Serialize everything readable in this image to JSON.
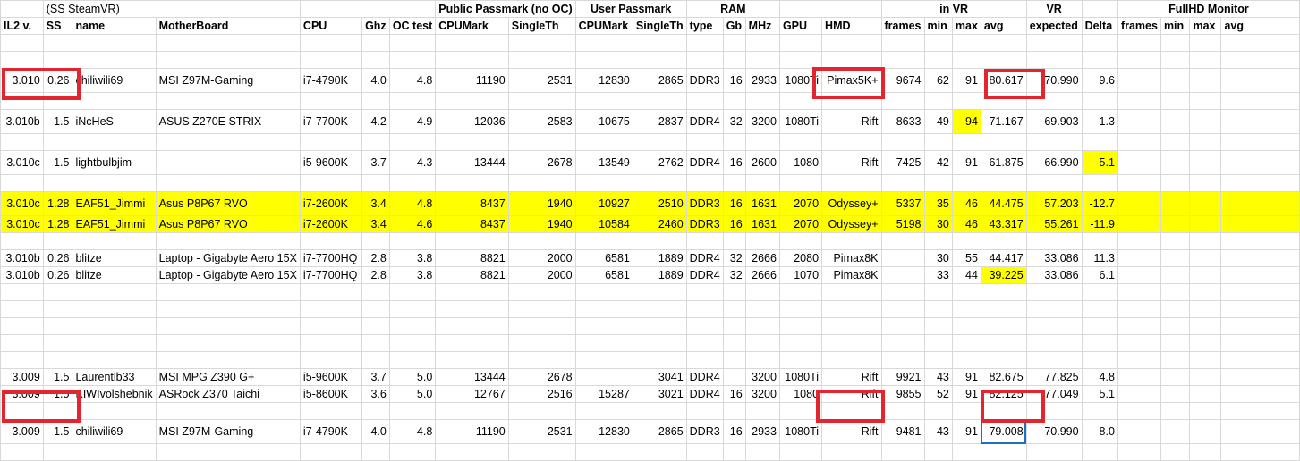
{
  "header": {
    "row1": {
      "ss_note": "(SS SteamVR)",
      "public_passmark": "Public Passmark (no OC)",
      "user_passmark": "User Passmark",
      "ram": "RAM",
      "in_vr": "in VR",
      "vr": "VR",
      "fullhd": "FullHD Monitor"
    },
    "columns": [
      "IL2 v.",
      "SS",
      "name",
      "MotherBoard",
      "CPU",
      "Ghz",
      "OC test",
      "CPUMark",
      "SingleTh",
      "CPUMark",
      "SingleTh",
      "type",
      "Gb",
      "MHz",
      "GPU",
      "HMD",
      "frames",
      "min",
      "max",
      "avg",
      "expected",
      "Delta",
      "frames",
      "min",
      "max",
      "avg"
    ]
  },
  "rows": [
    {
      "cells": [
        "3.010",
        "0.26",
        "chiliwili69",
        "MSI Z97M-Gaming",
        "i7-4790K",
        "4.0",
        "4.8",
        "11190",
        "2531",
        "12830",
        "2865",
        "DDR3",
        "16",
        "2933",
        "1080Ti",
        "Pimax5K+",
        "9674",
        "62",
        "91",
        "80.617",
        "70.990",
        "9.6"
      ]
    },
    {
      "cells": [
        "3.010b",
        "1.5",
        "iNcHeS",
        "ASUS Z270E STRIX",
        "i7-7700K",
        "4.2",
        "4.9",
        "12036",
        "2583",
        "10675",
        "2837",
        "DDR4",
        "32",
        "3200",
        "1080Ti",
        "Rift",
        "8633",
        "49",
        "94",
        "71.167",
        "69.903",
        "1.3"
      ]
    },
    {
      "cells": [
        "3.010c",
        "1.5",
        "lightbulbjim",
        "",
        "i5-9600K",
        "3.7",
        "4.3",
        "13444",
        "2678",
        "13549",
        "2762",
        "DDR4",
        "16",
        "2600",
        "1080",
        "Rift",
        "7425",
        "42",
        "91",
        "61.875",
        "66.990",
        "-5.1"
      ]
    },
    {
      "cells": [
        "3.010c",
        "1.28",
        "EAF51_Jimmi",
        "Asus P8P67 RVO",
        "i7-2600K",
        "3.4",
        "4.8",
        "8437",
        "1940",
        "10927",
        "2510",
        "DDR3",
        "16",
        "1631",
        "2070",
        "Odyssey+",
        "5337",
        "35",
        "46",
        "44.475",
        "57.203",
        "-12.7"
      ]
    },
    {
      "cells": [
        "3.010c",
        "1.28",
        "EAF51_Jimmi",
        "Asus P8P67 RVO",
        "i7-2600K",
        "3.4",
        "4.6",
        "8437",
        "1940",
        "10584",
        "2460",
        "DDR3",
        "16",
        "1631",
        "2070",
        "Odyssey+",
        "5198",
        "30",
        "46",
        "43.317",
        "55.261",
        "-11.9"
      ]
    },
    {
      "cells": [
        "3.010b",
        "0.26",
        "blitze",
        "Laptop - Gigabyte Aero 15X",
        "i7-7700HQ",
        "2.8",
        "3.8",
        "8821",
        "2000",
        "6581",
        "1889",
        "DDR4",
        "32",
        "2666",
        "2080",
        "Pimax8K",
        "",
        "30",
        "55",
        "44.417",
        "33.086",
        "11.3"
      ]
    },
    {
      "cells": [
        "3.010b",
        "0.26",
        "blitze",
        "Laptop - Gigabyte Aero 15X",
        "i7-7700HQ",
        "2.8",
        "3.8",
        "8821",
        "2000",
        "6581",
        "1889",
        "DDR4",
        "32",
        "2666",
        "1070",
        "Pimax8K",
        "",
        "33",
        "44",
        "39.225",
        "33.086",
        "6.1"
      ]
    },
    {
      "cells": [
        "3.009",
        "1.5",
        "Laurentlb33",
        "MSI MPG Z390 G+",
        "i5-9600K",
        "3.7",
        "5.0",
        "13444",
        "2678",
        "",
        "3041",
        "DDR4",
        "",
        "3200",
        "1080Ti",
        "Rift",
        "9921",
        "43",
        "91",
        "82.675",
        "77.825",
        "4.8"
      ]
    },
    {
      "cells": [
        "3.009",
        "1.5",
        "KIWIvolshebnik",
        "ASRock Z370 Taichi",
        "i5-8600K",
        "3.6",
        "5.0",
        "12767",
        "2516",
        "15287",
        "3021",
        "DDR4",
        "16",
        "3200",
        "1080",
        "Rift",
        "9855",
        "52",
        "91",
        "82.125",
        "77.049",
        "5.1"
      ]
    },
    {
      "cells": [
        "3.009",
        "1.5",
        "chiliwili69",
        "MSI Z97M-Gaming",
        "i7-4790K",
        "4.0",
        "4.8",
        "11190",
        "2531",
        "12830",
        "2865",
        "DDR3",
        "16",
        "2933",
        "1080Ti",
        "Rift",
        "9481",
        "43",
        "91",
        "79.008",
        "70.990",
        "8.0"
      ]
    }
  ],
  "colors": {
    "highlight": "#ffff00",
    "annotation": "#e2252f",
    "selection": "#1f6fc5",
    "gridline": "#d9d9d9"
  }
}
